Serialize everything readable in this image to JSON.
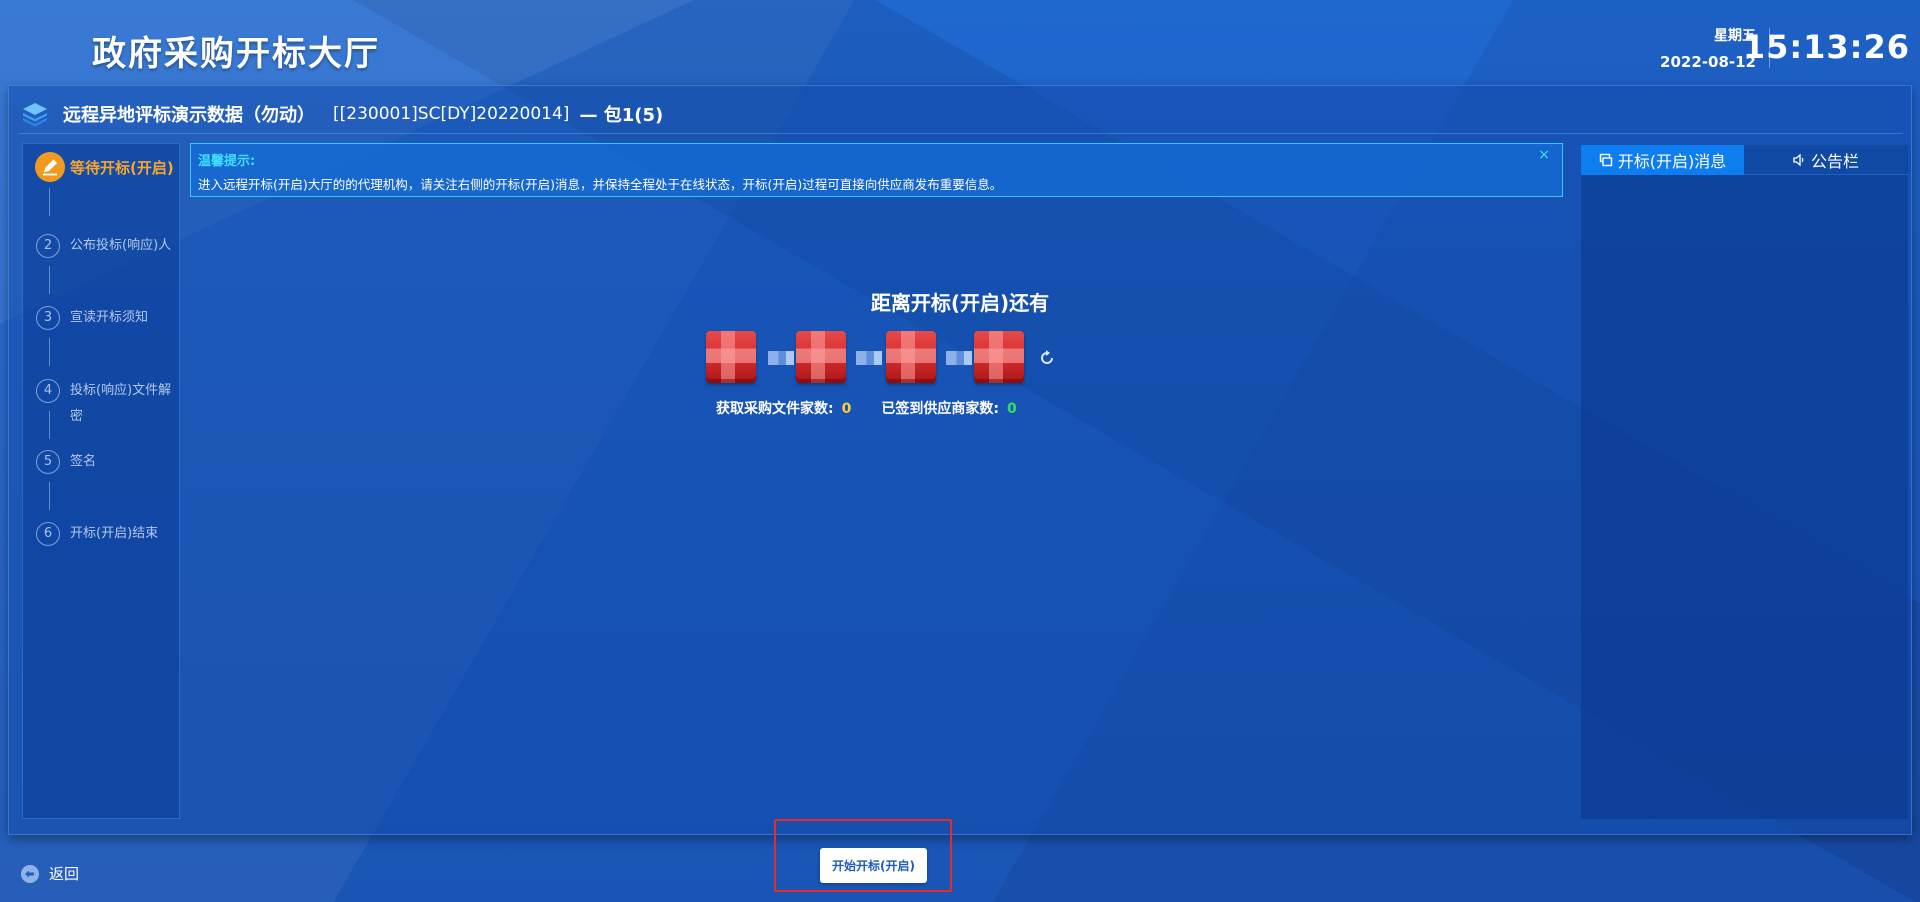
{
  "header": {
    "app_title": "政府采购开标大厅",
    "weekday": "星期五",
    "date": "2022-08-12",
    "time": "15:13:26"
  },
  "project": {
    "name": "远程异地评标演示数据（勿动）",
    "code": "[[230001]SC[DY]20220014]",
    "package": "— 包1(5)"
  },
  "steps": [
    {
      "number": "",
      "label": "等待开标(开启)",
      "active": true
    },
    {
      "number": "2",
      "label": "公布投标(响应)人",
      "active": false
    },
    {
      "number": "3",
      "label": "宣读开标须知",
      "active": false
    },
    {
      "number": "4",
      "label": "投标(响应)文件解密",
      "active": false
    },
    {
      "number": "5",
      "label": "签名",
      "active": false
    },
    {
      "number": "6",
      "label": "开标(开启)结束",
      "active": false
    }
  ],
  "tip": {
    "title": "温馨提示:",
    "text": "进入远程开标(开启)大厅的的代理机构，请关注右侧的开标(开启)消息，并保持全程处于在线状态，开标(开启)过程可直接向供应商发布重要信息。",
    "close": "×"
  },
  "countdown": {
    "title": "距离开标(开启)还有",
    "stat1_label": "获取采购文件家数:",
    "stat1_value": "0",
    "stat2_label": "已签到供应商家数:",
    "stat2_value": "0"
  },
  "message_panel": {
    "tab_messages": "开标(开启)消息",
    "tab_board": "公告栏"
  },
  "footer": {
    "back_label": "返回",
    "start_button": "开始开标(开启)"
  },
  "colors": {
    "accent_orange": "#f29a1f",
    "tip_cyan": "#3fe0ff",
    "stat_yellow": "#ffcc33",
    "stat_green": "#33e066",
    "highlight_red": "#e52b2b"
  },
  "icons": [
    "layers-icon",
    "pencil-icon",
    "refresh-icon",
    "message-icon",
    "speaker-icon",
    "back-arrow-icon",
    "close-icon"
  ]
}
